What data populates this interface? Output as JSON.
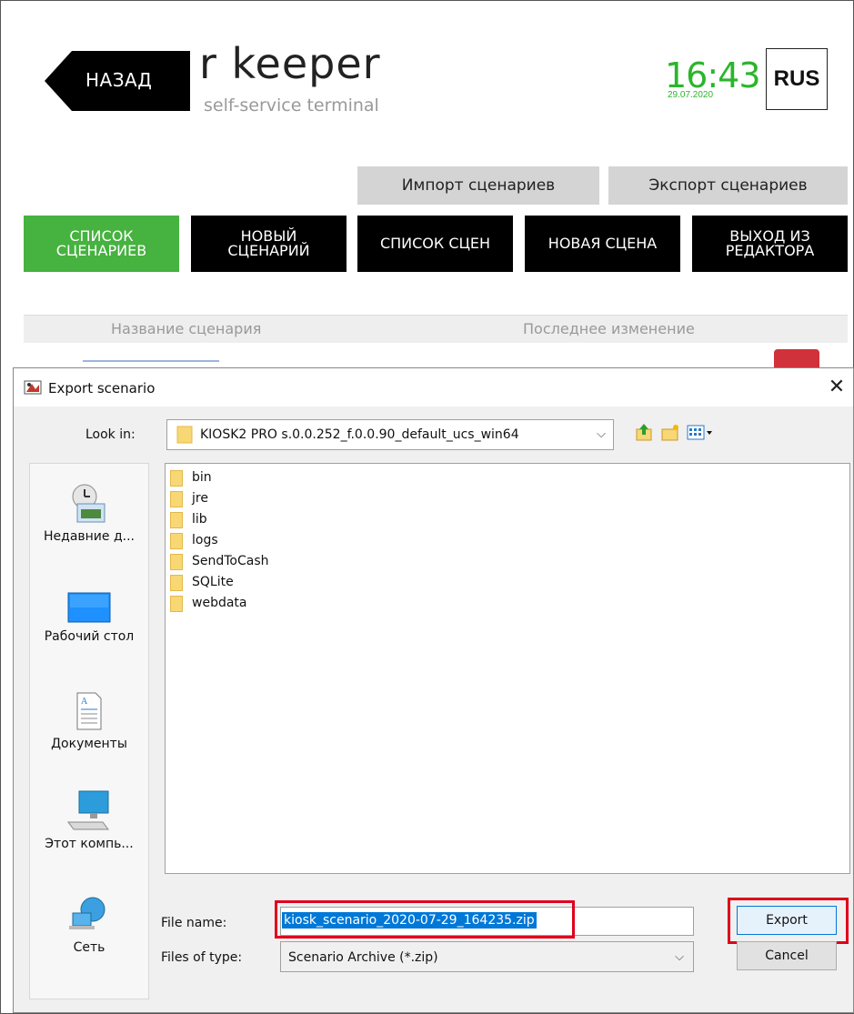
{
  "header": {
    "back_label": "НАЗАД",
    "logo_title": "r  keeper",
    "logo_subtitle": "self-service terminal",
    "time": "16:43",
    "date": "29.07.2020",
    "language": "RUS"
  },
  "actions": {
    "import_label": "Импорт сценариев",
    "export_label": "Экспорт сценариев"
  },
  "tabs": [
    {
      "label": "СПИСОК\nСЦЕНАРИЕВ",
      "active": true
    },
    {
      "label": "НОВЫЙ\nСЦЕНАРИЙ",
      "active": false
    },
    {
      "label": "СПИСОК СЦЕН",
      "active": false
    },
    {
      "label": "НОВАЯ СЦЕНА",
      "active": false
    },
    {
      "label": "ВЫХОД ИЗ\nРЕДАКТОРА",
      "active": false
    }
  ],
  "table": {
    "col_name": "Название сценария",
    "col_modified": "Последнее изменение"
  },
  "dialog": {
    "title": "Export scenario",
    "close_icon": "close-icon",
    "look_in_label": "Look in:",
    "look_in_value": "KIOSK2 PRO s.0.0.252_f.0.0.90_default_ucs_win64",
    "sidebar": [
      {
        "label": "Недавние д...",
        "icon": "recent-places-icon"
      },
      {
        "label": "Рабочий стол",
        "icon": "desktop-icon"
      },
      {
        "label": "Документы",
        "icon": "documents-icon"
      },
      {
        "label": "Этот компь...",
        "icon": "computer-icon"
      },
      {
        "label": "Сеть",
        "icon": "network-icon"
      }
    ],
    "files": [
      "bin",
      "jre",
      "lib",
      "logs",
      "SendToCash",
      "SQLite",
      "webdata"
    ],
    "file_name_label": "File name:",
    "file_name_value": "kiosk_scenario_2020-07-29_164235.zip",
    "files_of_type_label": "Files of type:",
    "files_of_type_value": "Scenario Archive (*.zip)",
    "export_button": "Export",
    "cancel_button": "Cancel"
  },
  "colors": {
    "accent_green": "#46b23f",
    "clock_green": "#2bb52b",
    "highlight_red": "#e0001b",
    "selection_blue": "#0078d7"
  }
}
